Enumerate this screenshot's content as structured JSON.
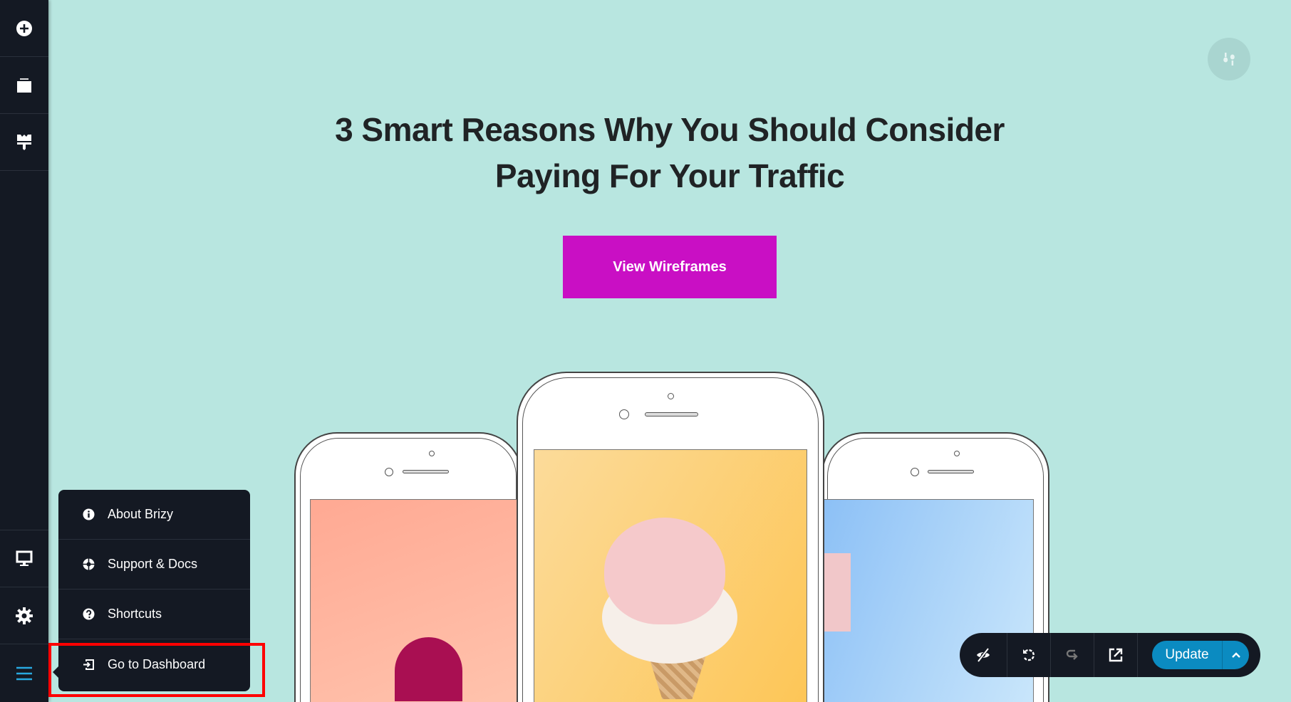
{
  "sidebar": {
    "top_items": [
      {
        "icon": "add-elements-icon"
      },
      {
        "icon": "blocks-icon"
      },
      {
        "icon": "styling-paint-brush-icon"
      }
    ],
    "bottom_items": [
      {
        "icon": "desktop-preview-icon"
      },
      {
        "icon": "settings-gear-icon"
      },
      {
        "icon": "hamburger-menu-icon",
        "active_color": "#28a9e0"
      }
    ]
  },
  "page": {
    "title": "3 Smart Reasons Why You Should Consider Paying For Your Traffic",
    "cta_label": "View Wireframes",
    "cta_color": "#c90fc4",
    "background": "#b8e6e0"
  },
  "menu": {
    "items": [
      {
        "label": "About Brizy",
        "icon": "info-icon"
      },
      {
        "label": "Support & Docs",
        "icon": "lifebuoy-icon"
      },
      {
        "label": "Shortcuts",
        "icon": "question-icon"
      },
      {
        "label": "Go to Dashboard",
        "icon": "exit-icon"
      }
    ]
  },
  "toolbar": {
    "update_label": "Update",
    "update_color": "#0b8bc1"
  }
}
